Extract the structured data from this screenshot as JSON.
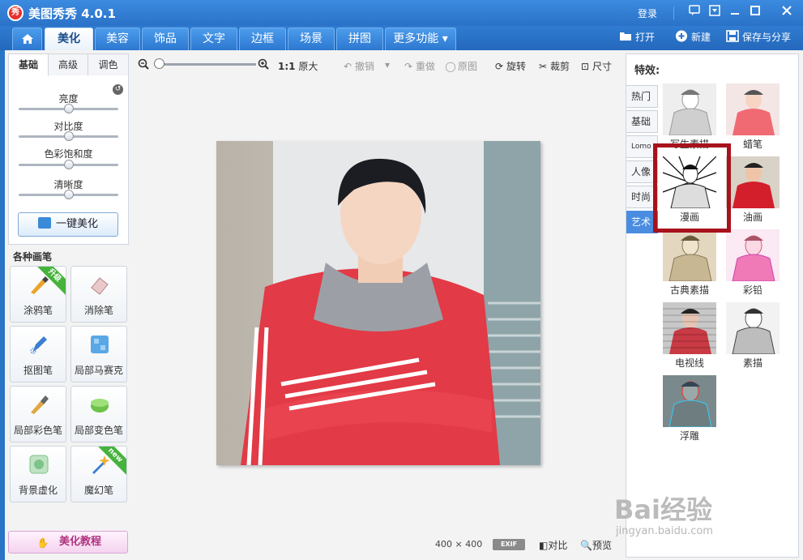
{
  "app": {
    "title": "美图秀秀 4.0.1",
    "logo": "秀",
    "login": "登录"
  },
  "window_controls": [
    "chat-icon",
    "menu-icon",
    "minimize-icon",
    "maximize-icon",
    "close-icon"
  ],
  "tabs": [
    {
      "label": "⌂",
      "icon": "home-icon"
    },
    {
      "label": "美化"
    },
    {
      "label": "美容"
    },
    {
      "label": "饰品"
    },
    {
      "label": "文字"
    },
    {
      "label": "边框"
    },
    {
      "label": "场景"
    },
    {
      "label": "拼图"
    },
    {
      "label": "更多功能 ▾"
    }
  ],
  "top_actions": {
    "open": "打开",
    "new": "新建",
    "save_share": "保存与分享"
  },
  "left": {
    "tabs": [
      "基础",
      "高级",
      "调色"
    ],
    "sliders": [
      {
        "label": "亮度",
        "value": 0.5
      },
      {
        "label": "对比度",
        "value": 0.5
      },
      {
        "label": "色彩饱和度",
        "value": 0.5
      },
      {
        "label": "清晰度",
        "value": 0.5
      }
    ],
    "one_click": "一键美化",
    "brush_title": "各种画笔",
    "brushes": [
      {
        "label": "涂鸦笔",
        "badge": "升级",
        "color": "#e9a22a"
      },
      {
        "label": "消除笔",
        "badge": "",
        "color": "#e9c9c9"
      },
      {
        "label": "抠图笔",
        "badge": "",
        "color": "#3b7fd0"
      },
      {
        "label": "局部马赛克",
        "badge": "",
        "color": "#5aa7e6"
      },
      {
        "label": "局部彩色笔",
        "badge": "",
        "color": "#e0a640"
      },
      {
        "label": "局部变色笔",
        "badge": "",
        "color": "#6cc24a"
      },
      {
        "label": "背景虚化",
        "badge": "",
        "color": "#7fc38a"
      },
      {
        "label": "魔幻笔",
        "badge": "new",
        "color": "#f0b030"
      }
    ],
    "tutorial": "美化教程"
  },
  "toolbar": {
    "zoom": 0.0,
    "ratio_bold": "1:1",
    "ratio_label": "原大",
    "undo": "撤销",
    "redo": "重做",
    "original": "原图",
    "rotate": "旋转",
    "crop": "裁剪",
    "size": "尺寸"
  },
  "image_info": {
    "width": "400",
    "x": "×",
    "height": "400",
    "exif": "EXIF",
    "compare": "对比",
    "preview": "预览"
  },
  "right": {
    "title": "特效:",
    "categories": [
      "热门",
      "基础",
      "Lomo",
      "人像",
      "时尚",
      "艺术"
    ],
    "active_category": "艺术",
    "effects": [
      {
        "label": "写生素描",
        "selected": false
      },
      {
        "label": "蜡笔",
        "selected": false
      },
      {
        "label": "漫画",
        "selected": true
      },
      {
        "label": "油画",
        "selected": false
      },
      {
        "label": "古典素描",
        "selected": false
      },
      {
        "label": "彩铅",
        "selected": false
      },
      {
        "label": "电视线",
        "selected": false
      },
      {
        "label": "素描",
        "selected": false
      },
      {
        "label": "浮雕",
        "selected": false
      }
    ]
  },
  "watermark": {
    "brand": "Bai经验",
    "url": "jingyan.baidu.com"
  }
}
